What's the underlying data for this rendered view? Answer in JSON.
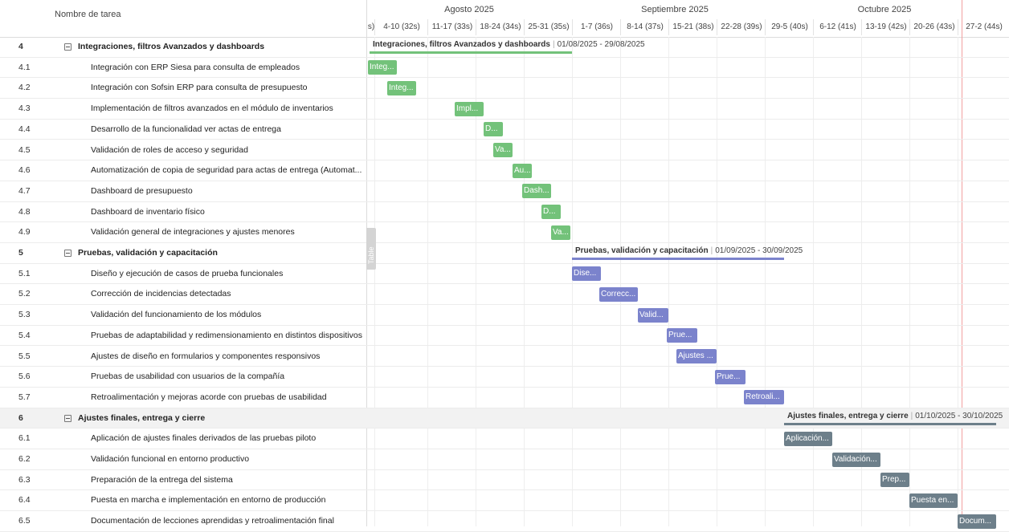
{
  "header": {
    "task_column": "Nombre de tarea",
    "months": [
      "Agosto 2025",
      "Septiembre 2025",
      "Octubre 2025"
    ],
    "weeks": [
      "s)",
      "4-10 (32s)",
      "11-17 (33s)",
      "18-24 (34s)",
      "25-31 (35s)",
      "1-7 (36s)",
      "8-14 (37s)",
      "15-21 (38s)",
      "22-28 (39s)",
      "29-5 (40s)",
      "6-12 (41s)",
      "13-19 (42s)",
      "20-26 (43s)",
      "27-2 (44s)"
    ]
  },
  "side_tab": "Table",
  "colors": {
    "green": "#73c27a",
    "blue": "#7b83cc",
    "gray": "#6d7f8a",
    "today": "#f2a0a0"
  },
  "rows": [
    {
      "num": "4",
      "name": "Integraciones, filtros Avanzados y dashboards",
      "summary": true
    },
    {
      "num": "4.1",
      "name": "Integración con ERP Siesa para consulta de empleados"
    },
    {
      "num": "4.2",
      "name": "Integración con Sofsin ERP para consulta de presupuesto"
    },
    {
      "num": "4.3",
      "name": "Implementación de filtros avanzados en el módulo de inventarios"
    },
    {
      "num": "4.4",
      "name": "Desarrollo de la funcionalidad ver actas de entrega"
    },
    {
      "num": "4.5",
      "name": "Validación de roles de acceso y seguridad"
    },
    {
      "num": "4.6",
      "name": "Automatización de copia de seguridad para actas de entrega (Automat..."
    },
    {
      "num": "4.7",
      "name": "Dashboard de presupuesto"
    },
    {
      "num": "4.8",
      "name": "Dashboard de inventario físico"
    },
    {
      "num": "4.9",
      "name": "Validación general de integraciones y ajustes menores"
    },
    {
      "num": "5",
      "name": "Pruebas, validación y capacitación",
      "summary": true
    },
    {
      "num": "5.1",
      "name": "Diseño y ejecución de casos de prueba funcionales"
    },
    {
      "num": "5.2",
      "name": "Corrección de incidencias detectadas"
    },
    {
      "num": "5.3",
      "name": "Validación del funcionamiento de los módulos"
    },
    {
      "num": "5.4",
      "name": "Pruebas de adaptabilidad y redimensionamiento en distintos dispositivos"
    },
    {
      "num": "5.5",
      "name": "Ajustes de diseño en formularios y componentes responsivos"
    },
    {
      "num": "5.6",
      "name": "Pruebas de usabilidad con usuarios de la compañía"
    },
    {
      "num": "5.7",
      "name": "Retroalimentación y mejoras acorde con pruebas de usabilidad"
    },
    {
      "num": "6",
      "name": "Ajustes finales, entrega y cierre",
      "summary": true
    },
    {
      "num": "6.1",
      "name": "Aplicación de ajustes finales derivados de las pruebas piloto"
    },
    {
      "num": "6.2",
      "name": "Validación funcional en entorno productivo"
    },
    {
      "num": "6.3",
      "name": "Preparación de la entrega del sistema"
    },
    {
      "num": "6.4",
      "name": "Puesta en marcha e implementación en entorno de producción"
    },
    {
      "num": "6.5",
      "name": "Documentación de lecciones aprendidas y retroalimentación final"
    }
  ],
  "summary_labels": [
    {
      "title": "Integraciones, filtros Avanzados y dashboards",
      "range": "01/08/2025 - 29/08/2025"
    },
    {
      "title": "Pruebas, validación y capacitación",
      "range": "01/09/2025 - 30/09/2025"
    },
    {
      "title": "Ajustes finales, entrega y cierre",
      "range": "01/10/2025 - 30/10/2025"
    }
  ],
  "bars": [
    {
      "label": "Integ...",
      "color": "green"
    },
    {
      "label": "Integ...",
      "color": "green"
    },
    {
      "label": "Impl...",
      "color": "green"
    },
    {
      "label": "D...",
      "color": "green"
    },
    {
      "label": "Va...",
      "color": "green"
    },
    {
      "label": "Au...",
      "color": "green"
    },
    {
      "label": "Dash...",
      "color": "green"
    },
    {
      "label": "D...",
      "color": "green"
    },
    {
      "label": "Va...",
      "color": "green"
    },
    {
      "label": "Dise...",
      "color": "blue"
    },
    {
      "label": "Correcc...",
      "color": "blue"
    },
    {
      "label": "Valid...",
      "color": "blue"
    },
    {
      "label": "Prue...",
      "color": "blue"
    },
    {
      "label": "Ajustes ...",
      "color": "blue"
    },
    {
      "label": "Prue...",
      "color": "blue"
    },
    {
      "label": "Retroali...",
      "color": "blue"
    },
    {
      "label": "Aplicación...",
      "color": "gray"
    },
    {
      "label": "Validación...",
      "color": "gray"
    },
    {
      "label": "Prep...",
      "color": "gray"
    },
    {
      "label": "Puesta en...",
      "color": "gray"
    },
    {
      "label": "Docum...",
      "color": "gray"
    }
  ]
}
